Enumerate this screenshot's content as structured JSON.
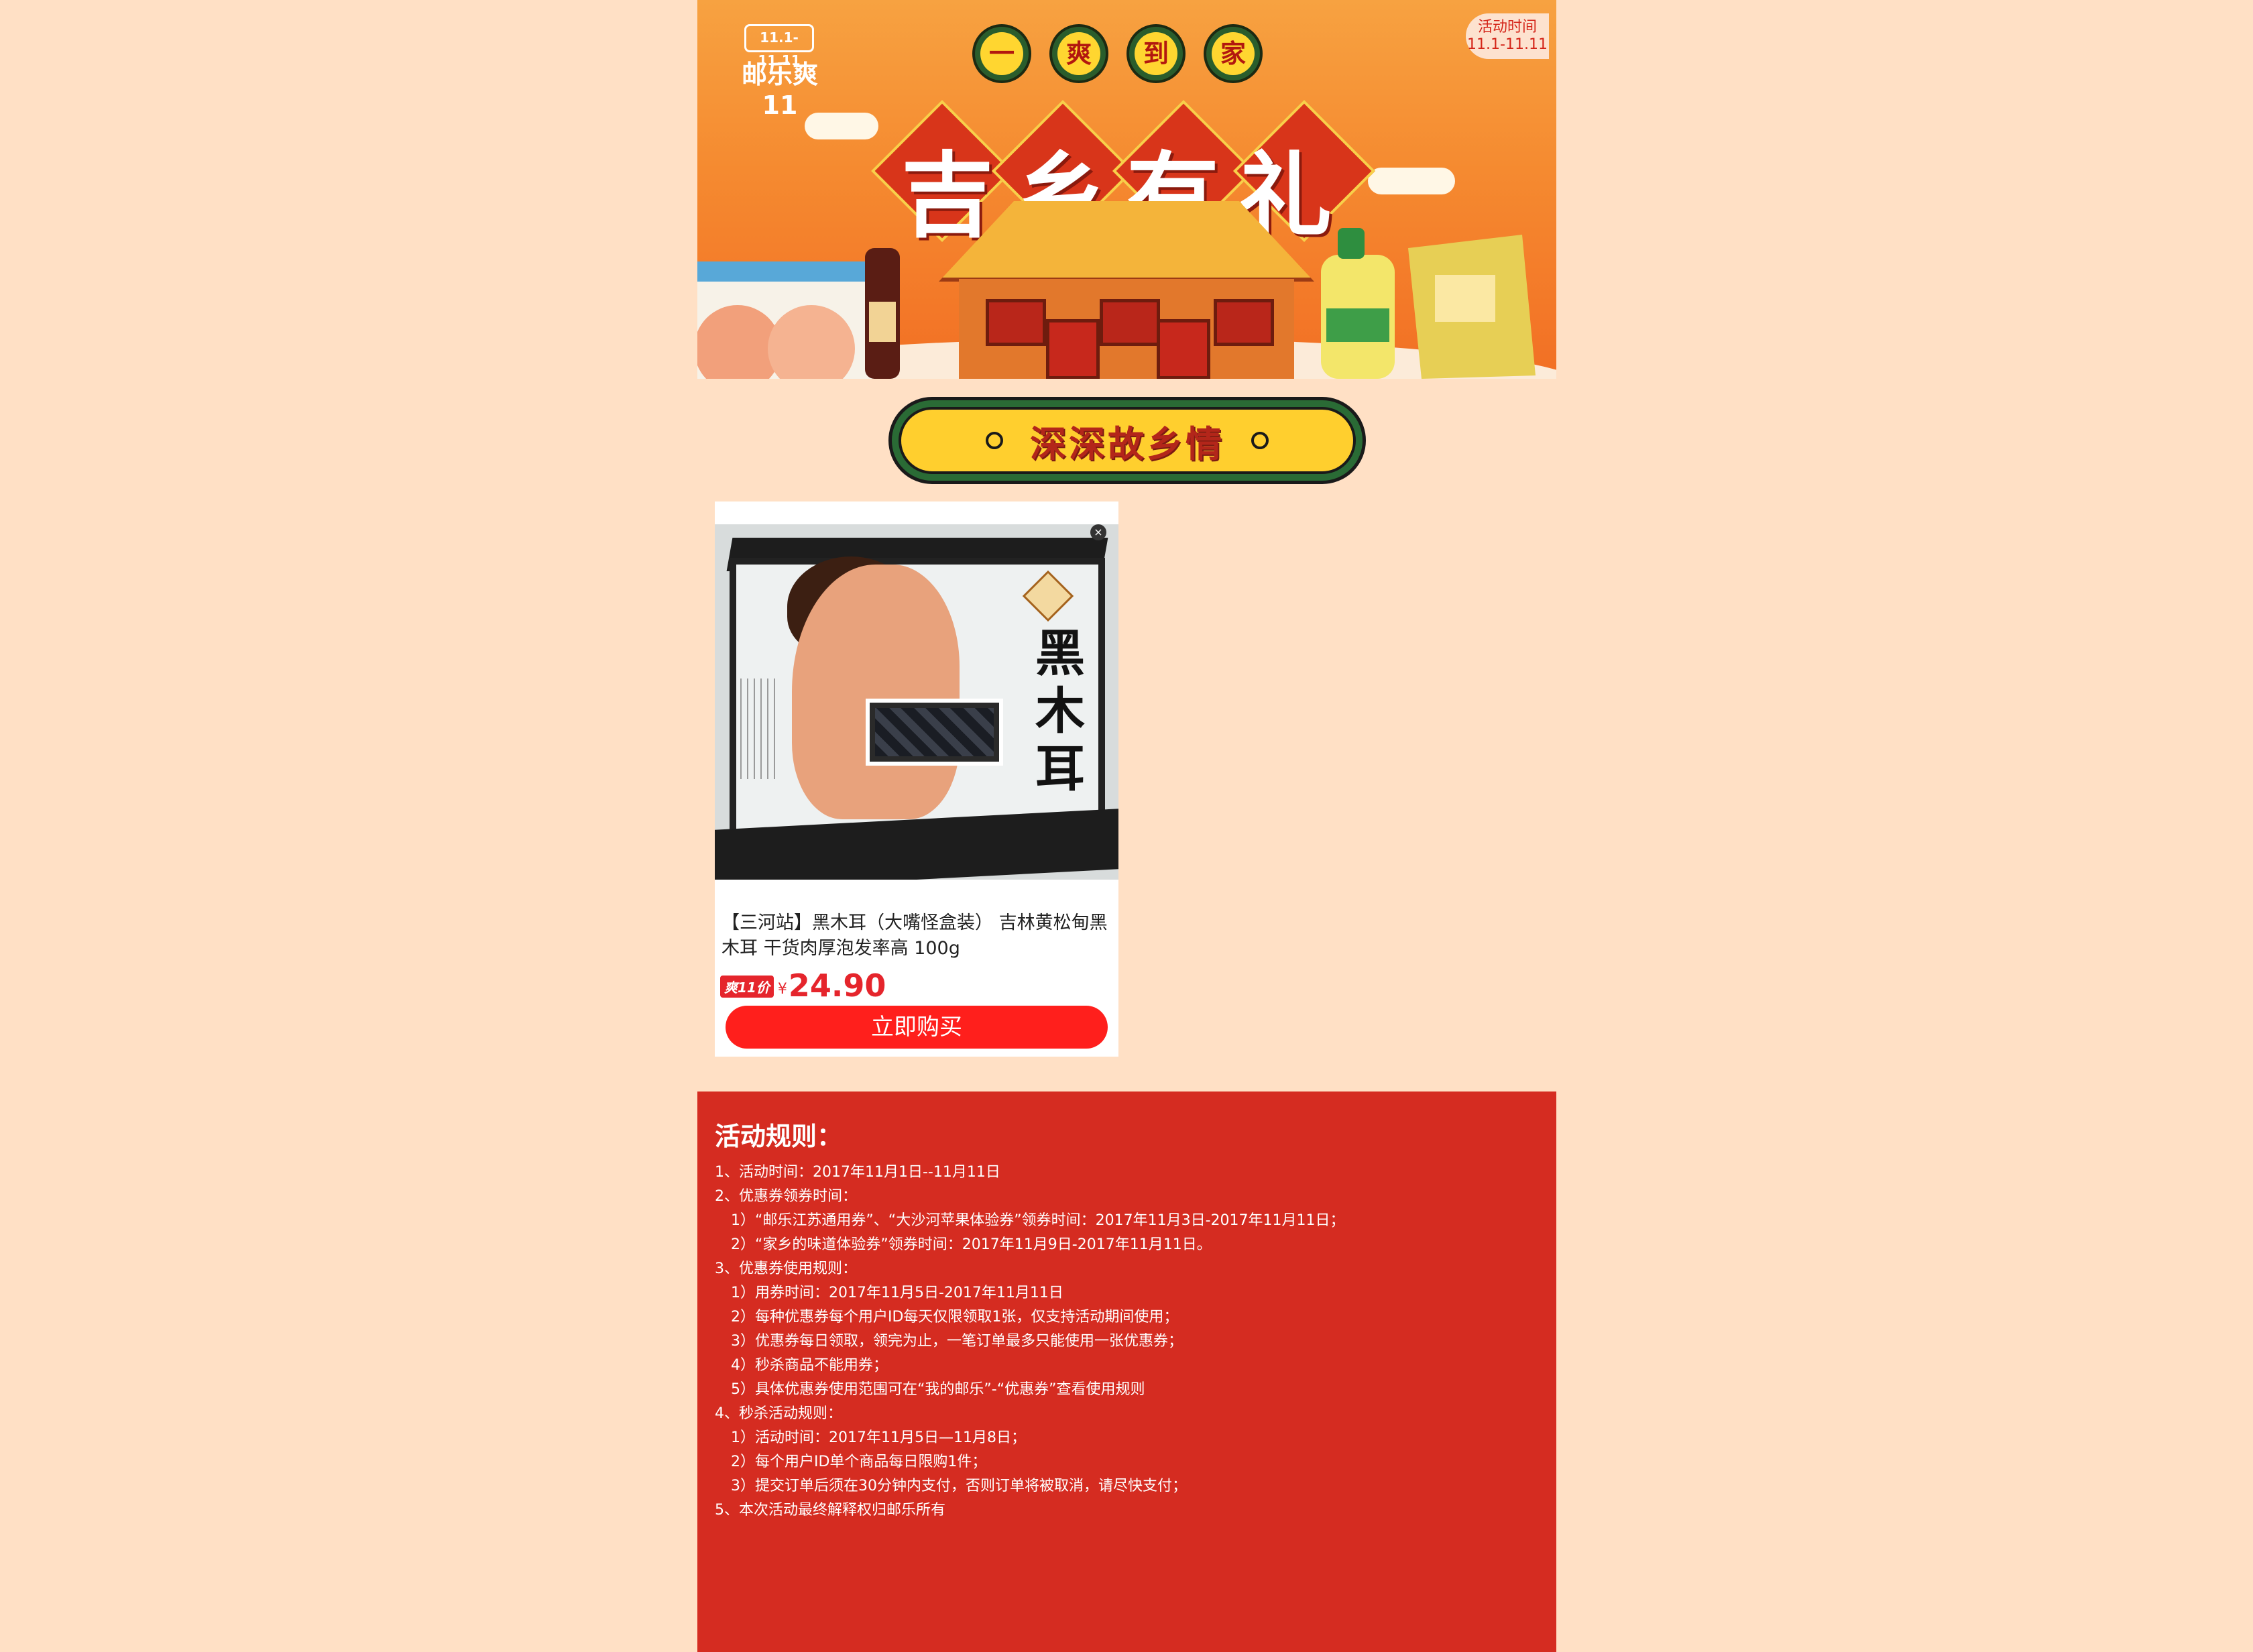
{
  "banner": {
    "logo_tag": "11.1-11.11",
    "logo_text": "邮乐爽11",
    "time_label": "活动时间",
    "time_range": "11.1-11.11",
    "coins": [
      "一",
      "爽",
      "到",
      "家"
    ],
    "slogan": "吉乡有礼",
    "accent_color": "#f58a30"
  },
  "section": {
    "title": "深深故乡情"
  },
  "product": {
    "image_label": "黑木耳",
    "title": "【三河站】黑木耳（大嘴怪盒装） 吉林黄松甸黑木耳 干货肉厚泡发率高 100g",
    "price_badge": "爽11价",
    "currency": "¥",
    "price": "24.90",
    "buy_label": "立即购买",
    "close_icon": "close-icon",
    "price_color": "#e5252c"
  },
  "rules": {
    "title": "活动规则：",
    "bg_color": "#d52c21",
    "lines": [
      {
        "sub": false,
        "text": "1、活动时间：2017年11月1日--11月11日"
      },
      {
        "sub": false,
        "text": "2、优惠券领券时间："
      },
      {
        "sub": true,
        "text": "1）“邮乐江苏通用券”、“大沙河苹果体验券”领券时间：2017年11月3日-2017年11月11日；"
      },
      {
        "sub": true,
        "text": "2）“家乡的味道体验券”领券时间：2017年11月9日-2017年11月11日。"
      },
      {
        "sub": false,
        "text": "3、优惠券使用规则："
      },
      {
        "sub": true,
        "text": "1）用券时间：2017年11月5日-2017年11月11日"
      },
      {
        "sub": true,
        "text": "2）每种优惠券每个用户ID每天仅限领取1张，仅支持活动期间使用；"
      },
      {
        "sub": true,
        "text": "3）优惠券每日领取，领完为止，一笔订单最多只能使用一张优惠券；"
      },
      {
        "sub": true,
        "text": "4）秒杀商品不能用券；"
      },
      {
        "sub": true,
        "text": "5）具体优惠券使用范围可在“我的邮乐”-“优惠券”查看使用规则"
      },
      {
        "sub": false,
        "text": "4、秒杀活动规则："
      },
      {
        "sub": true,
        "text": "1）活动时间：2017年11月5日—11月8日；"
      },
      {
        "sub": true,
        "text": "2）每个用户ID单个商品每日限购1件；"
      },
      {
        "sub": true,
        "text": "3）提交订单后须在30分钟内支付，否则订单将被取消，请尽快支付；"
      },
      {
        "sub": false,
        "text": "5、本次活动最终解释权归邮乐所有"
      }
    ]
  }
}
